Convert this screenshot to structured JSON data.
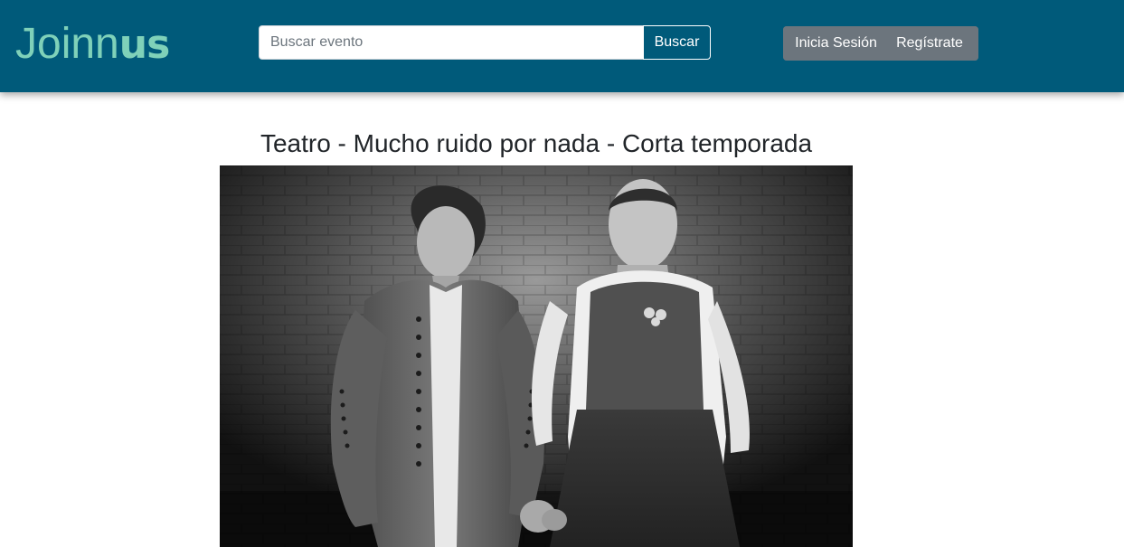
{
  "brand": {
    "logo_thin": "Joinn",
    "logo_bold": "us"
  },
  "search": {
    "placeholder": "Buscar evento",
    "value": "",
    "button_label": "Buscar"
  },
  "auth": {
    "login_label": "Inicia Sesión",
    "register_label": "Regístrate"
  },
  "event": {
    "title": "Teatro - Mucho ruido por nada - Corta temporada",
    "image_alt": "Two actors in period costume holding hands in front of a brick wall"
  },
  "colors": {
    "navbar": "#005a7a",
    "logo": "#7fd1b9",
    "auth_buttons": "#6c757d"
  }
}
